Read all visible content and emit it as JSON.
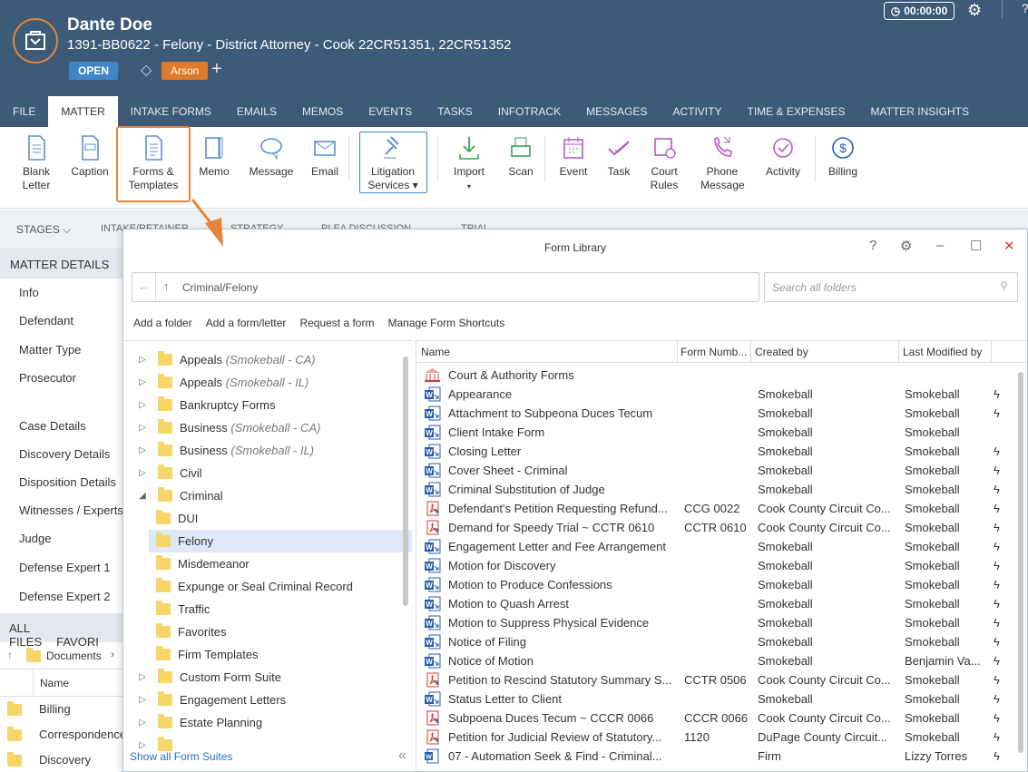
{
  "header": {
    "client_name": "Dante Doe",
    "matter_line": "1391-BB0622 - Felony - District Attorney - Cook 22CR51351, 22CR51352",
    "status": "OPEN",
    "tag": "Arson",
    "timer": "00:00:00"
  },
  "tabs": [
    "FILE",
    "MATTER",
    "INTAKE FORMS",
    "EMAILS",
    "MEMOS",
    "EVENTS",
    "TASKS",
    "INFOTRACK",
    "MESSAGES",
    "ACTIVITY",
    "TIME & EXPENSES",
    "MATTER INSIGHTS"
  ],
  "ribbon": {
    "blank_letter_1": "Blank",
    "blank_letter_2": "Letter",
    "caption": "Caption",
    "forms_1": "Forms &",
    "forms_2": "Templates",
    "memo": "Memo",
    "message": "Message",
    "email": "Email",
    "litigation_1": "Litigation",
    "litigation_2": "Services ▾",
    "import": "Import",
    "scan": "Scan",
    "event": "Event",
    "task": "Task",
    "court_1": "Court",
    "court_2": "Rules",
    "phone_1": "Phone",
    "phone_2": "Message",
    "activity": "Activity",
    "billing": "Billing"
  },
  "stages": {
    "label": "STAGES",
    "items": [
      "INTAKE/RETAINER",
      "STRATEGY",
      "PLEA DISCUSSION",
      "TRIAL"
    ]
  },
  "left": {
    "section": "MATTER DETAILS",
    "items": [
      "Info",
      "Defendant",
      "Matter Type",
      "Prosecutor",
      "Case Details",
      "Discovery Details",
      "Disposition Details",
      "Witnesses / Experts",
      "Judge",
      "Defense Expert 1",
      "Defense Expert 2"
    ],
    "files_tab": "ALL FILES",
    "fav_tab": "FAVORI",
    "doc_path": "Documents",
    "name_header": "Name",
    "folders": [
      "Billing",
      "Correspondence",
      "Discovery"
    ]
  },
  "dialog": {
    "title": "Form Library",
    "path": "Criminal/Felony",
    "search_placeholder": "Search all folders",
    "actions": [
      "Add a folder",
      "Add a form/letter",
      "Request a form",
      "Manage Form Shortcuts"
    ],
    "show_all": "Show all Form Suites",
    "tree": [
      {
        "name": "Appeals",
        "sub": "(Smokeball - CA)",
        "level": 0,
        "caret": "▷"
      },
      {
        "name": "Appeals",
        "sub": "(Smokeball - IL)",
        "level": 0,
        "caret": "▷"
      },
      {
        "name": "Bankruptcy Forms",
        "sub": "",
        "level": 0,
        "caret": "▷"
      },
      {
        "name": "Business",
        "sub": "(Smokeball - CA)",
        "level": 0,
        "caret": "▷"
      },
      {
        "name": "Business",
        "sub": "(Smokeball - IL)",
        "level": 0,
        "caret": "▷"
      },
      {
        "name": "Civil",
        "sub": "",
        "level": 0,
        "caret": "▷"
      },
      {
        "name": "Criminal",
        "sub": "",
        "level": 0,
        "caret": "◢"
      },
      {
        "name": "DUI",
        "sub": "",
        "level": 1,
        "caret": ""
      },
      {
        "name": "Felony",
        "sub": "",
        "level": 1,
        "caret": ""
      },
      {
        "name": "Misdemeanor",
        "sub": "",
        "level": 1,
        "caret": ""
      },
      {
        "name": "Expunge or Seal Criminal Record",
        "sub": "",
        "level": 1,
        "caret": ""
      },
      {
        "name": "Traffic",
        "sub": "",
        "level": 1,
        "caret": ""
      },
      {
        "name": "Favorites",
        "sub": "",
        "level": 1,
        "caret": ""
      },
      {
        "name": "Firm Templates",
        "sub": "",
        "level": 1,
        "caret": ""
      },
      {
        "name": "Custom Form Suite",
        "sub": "",
        "level": 0,
        "caret": "▷"
      },
      {
        "name": "Engagement Letters",
        "sub": "",
        "level": 0,
        "caret": "▷"
      },
      {
        "name": "Estate Planning",
        "sub": "",
        "level": 0,
        "caret": "▷"
      }
    ],
    "columns": [
      "Name",
      "Form Numb...",
      "Created by",
      "Last Modified by"
    ],
    "rows": [
      {
        "icon": "court",
        "name": "Court & Authority Forms",
        "num": "",
        "created": "",
        "modified": "",
        "bolt": ""
      },
      {
        "icon": "word",
        "name": "Appearance",
        "num": "",
        "created": "Smokeball",
        "modified": "Smokeball",
        "bolt": "ϟ"
      },
      {
        "icon": "word",
        "name": "Attachment to Subpeona Duces Tecum",
        "num": "",
        "created": "Smokeball",
        "modified": "Smokeball",
        "bolt": "ϟ"
      },
      {
        "icon": "word",
        "name": "Client Intake Form",
        "num": "",
        "created": "Smokeball",
        "modified": "Smokeball",
        "bolt": ""
      },
      {
        "icon": "word",
        "name": "Closing Letter",
        "num": "",
        "created": "Smokeball",
        "modified": "Smokeball",
        "bolt": "ϟ"
      },
      {
        "icon": "word",
        "name": "Cover Sheet - Criminal",
        "num": "",
        "created": "Smokeball",
        "modified": "Smokeball",
        "bolt": "ϟ"
      },
      {
        "icon": "word",
        "name": "Criminal Substitution of Judge",
        "num": "",
        "created": "Smokeball",
        "modified": "Smokeball",
        "bolt": "ϟ"
      },
      {
        "icon": "pdf",
        "name": "Defendant's Petition Requesting Refund...",
        "num": "CCG 0022",
        "created": "Cook County Circuit Co...",
        "modified": "Smokeball",
        "bolt": "ϟ"
      },
      {
        "icon": "pdf",
        "name": "Demand for Speedy Trial ~ CCTR 0610",
        "num": "CCTR 0610",
        "created": "Cook County Circuit Co...",
        "modified": "Smokeball",
        "bolt": "ϟ"
      },
      {
        "icon": "word",
        "name": "Engagement Letter and Fee Arrangement",
        "num": "",
        "created": "Smokeball",
        "modified": "Smokeball",
        "bolt": "ϟ"
      },
      {
        "icon": "word",
        "name": "Motion for Discovery",
        "num": "",
        "created": "Smokeball",
        "modified": "Smokeball",
        "bolt": "ϟ"
      },
      {
        "icon": "word",
        "name": "Motion to Produce Confessions",
        "num": "",
        "created": "Smokeball",
        "modified": "Smokeball",
        "bolt": "ϟ"
      },
      {
        "icon": "word",
        "name": "Motion to Quash Arrest",
        "num": "",
        "created": "Smokeball",
        "modified": "Smokeball",
        "bolt": "ϟ"
      },
      {
        "icon": "word",
        "name": "Motion to Suppress Physical Evidence",
        "num": "",
        "created": "Smokeball",
        "modified": "Smokeball",
        "bolt": "ϟ"
      },
      {
        "icon": "word",
        "name": "Notice of Filing",
        "num": "",
        "created": "Smokeball",
        "modified": "Smokeball",
        "bolt": "ϟ"
      },
      {
        "icon": "word",
        "name": "Notice of Motion",
        "num": "",
        "created": "Smokeball",
        "modified": "Benjamin Va...",
        "bolt": "ϟ"
      },
      {
        "icon": "pdf",
        "name": "Petition to Rescind Statutory Summary S...",
        "num": "CCTR 0506",
        "created": "Cook County Circuit Co...",
        "modified": "Smokeball",
        "bolt": "ϟ"
      },
      {
        "icon": "word",
        "name": "Status Letter to Client",
        "num": "",
        "created": "Smokeball",
        "modified": "Smokeball",
        "bolt": "ϟ"
      },
      {
        "icon": "pdf",
        "name": "Subpoena Duces Tecum ~ CCCR 0066",
        "num": "CCCR 0066",
        "created": "Cook County Circuit Co...",
        "modified": "Smokeball",
        "bolt": "ϟ"
      },
      {
        "icon": "pdf",
        "name": "Petition for Judicial Review of Statutory...",
        "num": "1120",
        "created": "DuPage County Circuit...",
        "modified": "Smokeball",
        "bolt": "ϟ"
      },
      {
        "icon": "word2",
        "name": "07 - Automation Seek & Find - Criminal...",
        "num": "",
        "created": "Firm",
        "modified": "Lizzy Torres",
        "bolt": "ϟ"
      }
    ]
  },
  "colors": {
    "header_bg": "#3d5a78",
    "accent_orange": "#e8833a",
    "word_blue": "#2b5fad",
    "pdf_red": "#d33b2f",
    "ribbon_icon": "#5b8fd0"
  }
}
